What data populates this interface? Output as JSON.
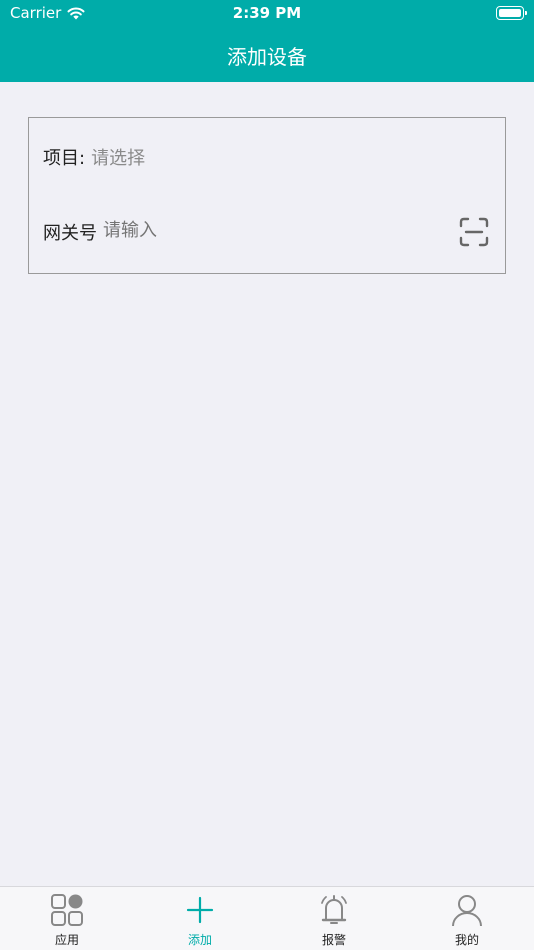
{
  "status_bar": {
    "carrier": "Carrier",
    "time": "2:39 PM"
  },
  "header": {
    "title": "添加设备"
  },
  "form": {
    "project_label": "项目:",
    "project_placeholder": "请选择",
    "gateway_label": "网关号",
    "gateway_placeholder": "请输入"
  },
  "tabbar": {
    "items": [
      {
        "label": "应用",
        "icon": "apps-icon"
      },
      {
        "label": "添加",
        "icon": "plus-icon"
      },
      {
        "label": "报警",
        "icon": "bell-icon"
      },
      {
        "label": "我的",
        "icon": "user-icon"
      }
    ],
    "active_index": 1
  },
  "colors": {
    "accent": "#00aca9",
    "background": "#f0f0f6",
    "inactive_icon": "#888888"
  }
}
